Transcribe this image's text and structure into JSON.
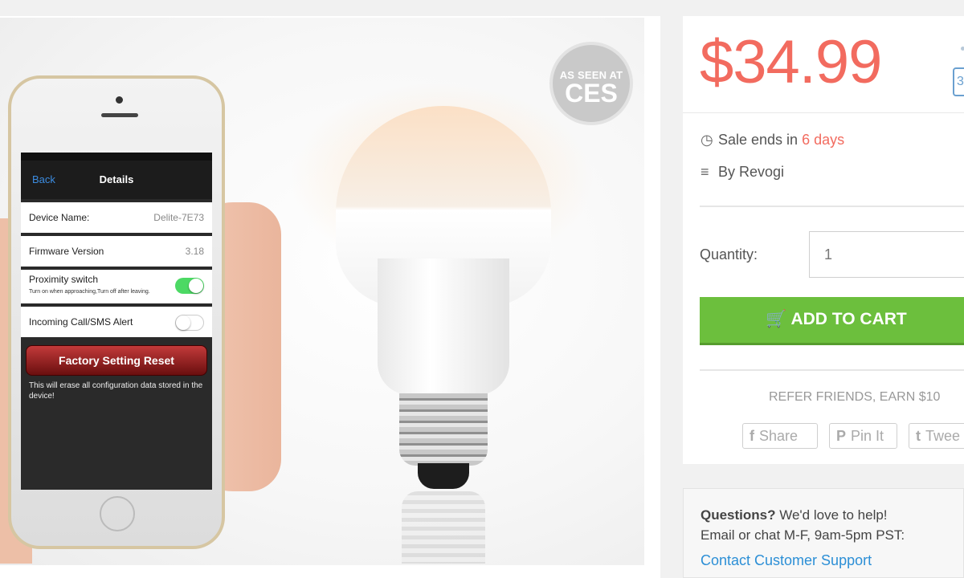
{
  "product_image": {
    "badge_line1": "AS SEEN AT",
    "badge_line2": "CES",
    "phone_screen": {
      "nav_back": "Back",
      "nav_title": "Details",
      "rows": [
        {
          "label": "Device Name:",
          "value": "Delite-7E73"
        },
        {
          "label": "Firmware Version",
          "value": "3.18"
        }
      ],
      "proximity_label": "Proximity switch",
      "proximity_sub": "Turn on when approaching,Turn off after leaving.",
      "call_alert_label": "Incoming Call/SMS Alert",
      "reset_button": "Factory Setting Reset",
      "reset_warning": "This will erase all configuration data stored in the device!"
    }
  },
  "buy_box": {
    "price": "$34.99",
    "badge_partial": "3",
    "sale_prefix": "Sale ends in ",
    "sale_days": "6 days",
    "by_label": "By Revogi",
    "quantity_label": "Quantity:",
    "quantity_value": "1",
    "add_to_cart": "ADD TO CART",
    "refer": "REFER FRIENDS, EARN $10",
    "share_buttons": [
      {
        "icon": "f",
        "label": "Share"
      },
      {
        "icon": "P",
        "label": "Pin It"
      },
      {
        "icon": "t",
        "label": "Twee"
      }
    ]
  },
  "help": {
    "question": "Questions?",
    "question_rest": " We'd love to help!",
    "hours": "Email or chat M-F, 9am-5pm PST:",
    "link": "Contact Customer Support"
  },
  "colors": {
    "price": "#f26b5f",
    "cart_button": "#6cbf3d",
    "link": "#2c8fd6"
  }
}
